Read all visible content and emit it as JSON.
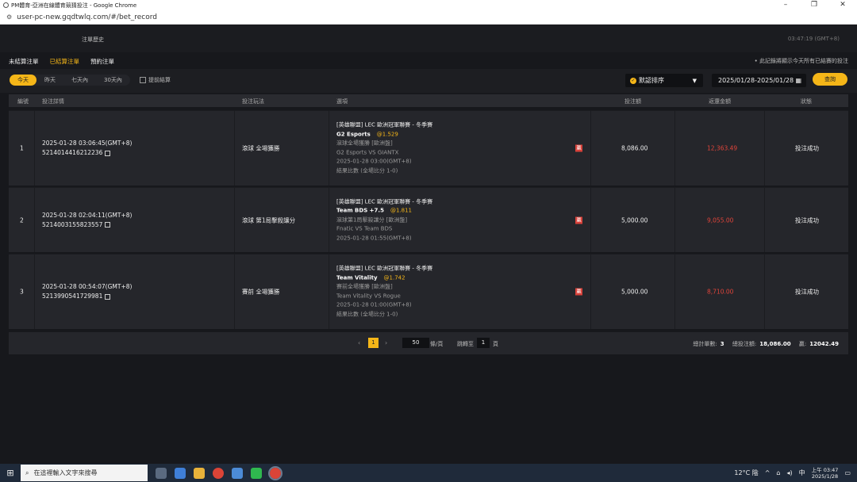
{
  "window": {
    "title": "PM體育-亞洲在線體育競猜投注 - Google Chrome",
    "url": "user-pc-new.gqdtwlq.com/#/bet_record"
  },
  "header": {
    "title": "注單歷史",
    "clock": "03:47:19 (GMT+8)"
  },
  "tabs": [
    {
      "label": "未結算注單"
    },
    {
      "label": "已結算注單"
    },
    {
      "label": "預約注單"
    }
  ],
  "note": "• 此記錄將顯示今天所有已結賽的投注",
  "filters": {
    "ranges": [
      {
        "label": "今天"
      },
      {
        "label": "昨天"
      },
      {
        "label": "七天內"
      },
      {
        "label": "30天內"
      }
    ],
    "early_settle_label": "提前結算",
    "sort_label": "默認排序",
    "date_range": "2025/01/28-2025/01/28",
    "query_label": "查詢"
  },
  "columns": {
    "no": "編號",
    "detail": "投注詳情",
    "play": "投注玩法",
    "option": "選項",
    "amount": "投注額",
    "return": "返還金額",
    "status": "狀態"
  },
  "rows": [
    {
      "no": "1",
      "time": "2025-01-28 03:06:45(GMT+8)",
      "bet_id": "5214014416212236",
      "play": "滾球  全場獲勝",
      "league": "[英雄聯盟] LEC 歐洲冠軍聯賽 - 冬季賽",
      "team": "G2 Esports",
      "odds": "@1.529",
      "sub1": "滾球全場獲勝 [歐洲盤]",
      "match": "G2 Esports VS GIANTX",
      "match_time": "2025-01-28 03:00(GMT+8)",
      "result": "結果比數 (全場比分 1-0)",
      "badge": "贏",
      "amount": "8,086.00",
      "return": "12,363.49",
      "status": "投注成功"
    },
    {
      "no": "2",
      "time": "2025-01-28 02:04:11(GMT+8)",
      "bet_id": "5214003155823557",
      "play": "滾球  第1局擊殺讓分",
      "league": "[英雄聯盟] LEC 歐洲冠軍聯賽 - 冬季賽",
      "team": "Team BDS +7.5",
      "odds": "@1.811",
      "sub1": "滾球第1局擊殺讓分 [歐洲盤]",
      "match": "Fnatic VS Team BDS",
      "match_time": "2025-01-28 01:55(GMT+8)",
      "result": "",
      "badge": "贏",
      "amount": "5,000.00",
      "return": "9,055.00",
      "status": "投注成功"
    },
    {
      "no": "3",
      "time": "2025-01-28 00:54:07(GMT+8)",
      "bet_id": "5213990541729981",
      "play": "賽前  全場獲勝",
      "league": "[英雄聯盟] LEC 歐洲冠軍聯賽 - 冬季賽",
      "team": "Team Vitality",
      "odds": "@1.742",
      "sub1": "賽前全場獲勝 [歐洲盤]",
      "match": "Team Vitality VS Rogue",
      "match_time": "2025-01-28 01:00(GMT+8)",
      "result": "結果比數 (全場比分 1-0)",
      "badge": "贏",
      "amount": "5,000.00",
      "return": "8,710.00",
      "status": "投注成功"
    }
  ],
  "pager": {
    "current": "1",
    "page_size": "50",
    "per_page_label": "條/頁",
    "jump_label": "跳轉至",
    "jump_value": "1",
    "page_unit": "頁",
    "total_label": "總計單數:",
    "total_count": "3",
    "total_bet_label": "總投注額:",
    "total_bet": "18,086.00",
    "win_label": "贏:",
    "win_total": "12042.49"
  },
  "taskbar": {
    "search_placeholder": "在這裡輸入文字來搜尋",
    "weather": "12°C 陰",
    "ime": "中",
    "time": "上午 03:47",
    "date": "2025/1/28"
  }
}
